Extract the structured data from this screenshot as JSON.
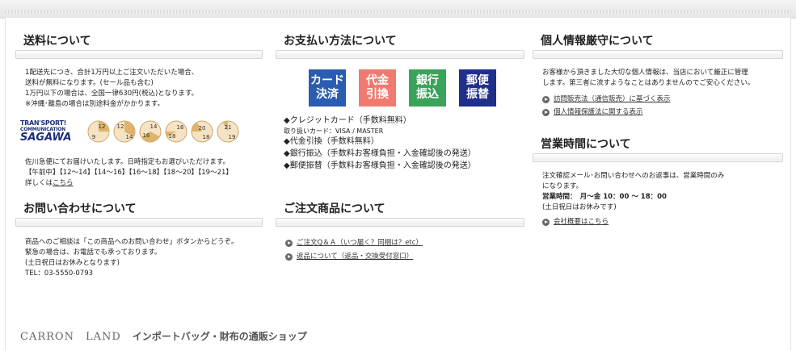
{
  "shipping": {
    "title": "送料について",
    "lines": [
      "1配送先につき、合計1万円以上ご注文いただいた場合、",
      "送料が無料になります。(セール品も含む)",
      "1万円以下の場合は、全国一律630円(税込)となります。",
      "※沖縄･離島の場合は別途料金がかかります。"
    ],
    "logo_line1": "TRAN'SPORT!",
    "logo_line2": "COMMUNICATION",
    "logo_main": "SAGAWA",
    "clocks": [
      {
        "top": "12",
        "bottom": "9"
      },
      {
        "top": "12",
        "bottom": "14"
      },
      {
        "top": "14",
        "bottom": "16"
      },
      {
        "top": "16",
        "bottom": "18"
      },
      {
        "top": "20",
        "bottom": "18"
      },
      {
        "top": "21",
        "bottom": "19"
      }
    ],
    "after_lines": [
      "佐川急便にてお届けいたします。日時指定もお選びいただけます。",
      "【午前中】【12～14】【14～16】【16～18】【18～20】【19～21】"
    ],
    "detail_prefix": "詳しくは",
    "detail_link": "こちら"
  },
  "inquiry": {
    "title": "お問い合わせについて",
    "lines": [
      "商品へのご相談は「この商品へのお問い合わせ」ボタンからどうぞ。",
      "緊急の場合は、お電話でも承っております。",
      "(土日祝日はお休みとなります)",
      "TEL：03-5550-0793"
    ]
  },
  "payment": {
    "title": "お支払い方法について",
    "buttons": [
      {
        "line1": "カード",
        "line2": "決済",
        "color": "#2a5db0"
      },
      {
        "line1": "代金",
        "line2": "引換",
        "color": "#f07a70"
      },
      {
        "line1": "銀行",
        "line2": "振込",
        "color": "#3aa35a"
      },
      {
        "line1": "郵便",
        "line2": "振替",
        "color": "#1f2f8a"
      }
    ],
    "card_line": "◆クレジットカード（手数料無料）",
    "card_sub": "取り扱いカード：VISA / MASTER",
    "cod_line": "◆代金引換（手数料無料）",
    "bank_line": "◆銀行振込（手数料お客様負担・入金確認後の発送）",
    "postal_line": "◆郵便振替（手数料お客様負担・入金確認後の発送）"
  },
  "orders": {
    "title": "ご注文商品について",
    "links": [
      "ご注文Q＆Ａ（いつ届く？同梱は？etc）",
      "返品について（返品・交換受付窓口）"
    ]
  },
  "privacy": {
    "title": "個人情報厳守について",
    "lines": [
      "お客様から頂きました大切な個人情報は、当店において厳正に管理",
      "します。第三者に流すようなことはありませんのでご安心ください。"
    ],
    "links": [
      "訪問販売法（通信販売）に基づく表示",
      "個人情報保護法に関する表示"
    ]
  },
  "hours": {
    "title": "営業時間について",
    "lines": [
      "注文確認メール･お問い合わせへのお返事は、営業時間のみ",
      "になります。"
    ],
    "hours_label": "営業時間",
    "hours_value": "：　月～金 10：00 ～ 18：00",
    "closed": "(土日祝日はお休みです)",
    "company_link": "会社概要はこちら"
  },
  "footer": {
    "brand": "CARRON　LAND",
    "tagline": "インポートバッグ・財布の通販ショップ"
  }
}
